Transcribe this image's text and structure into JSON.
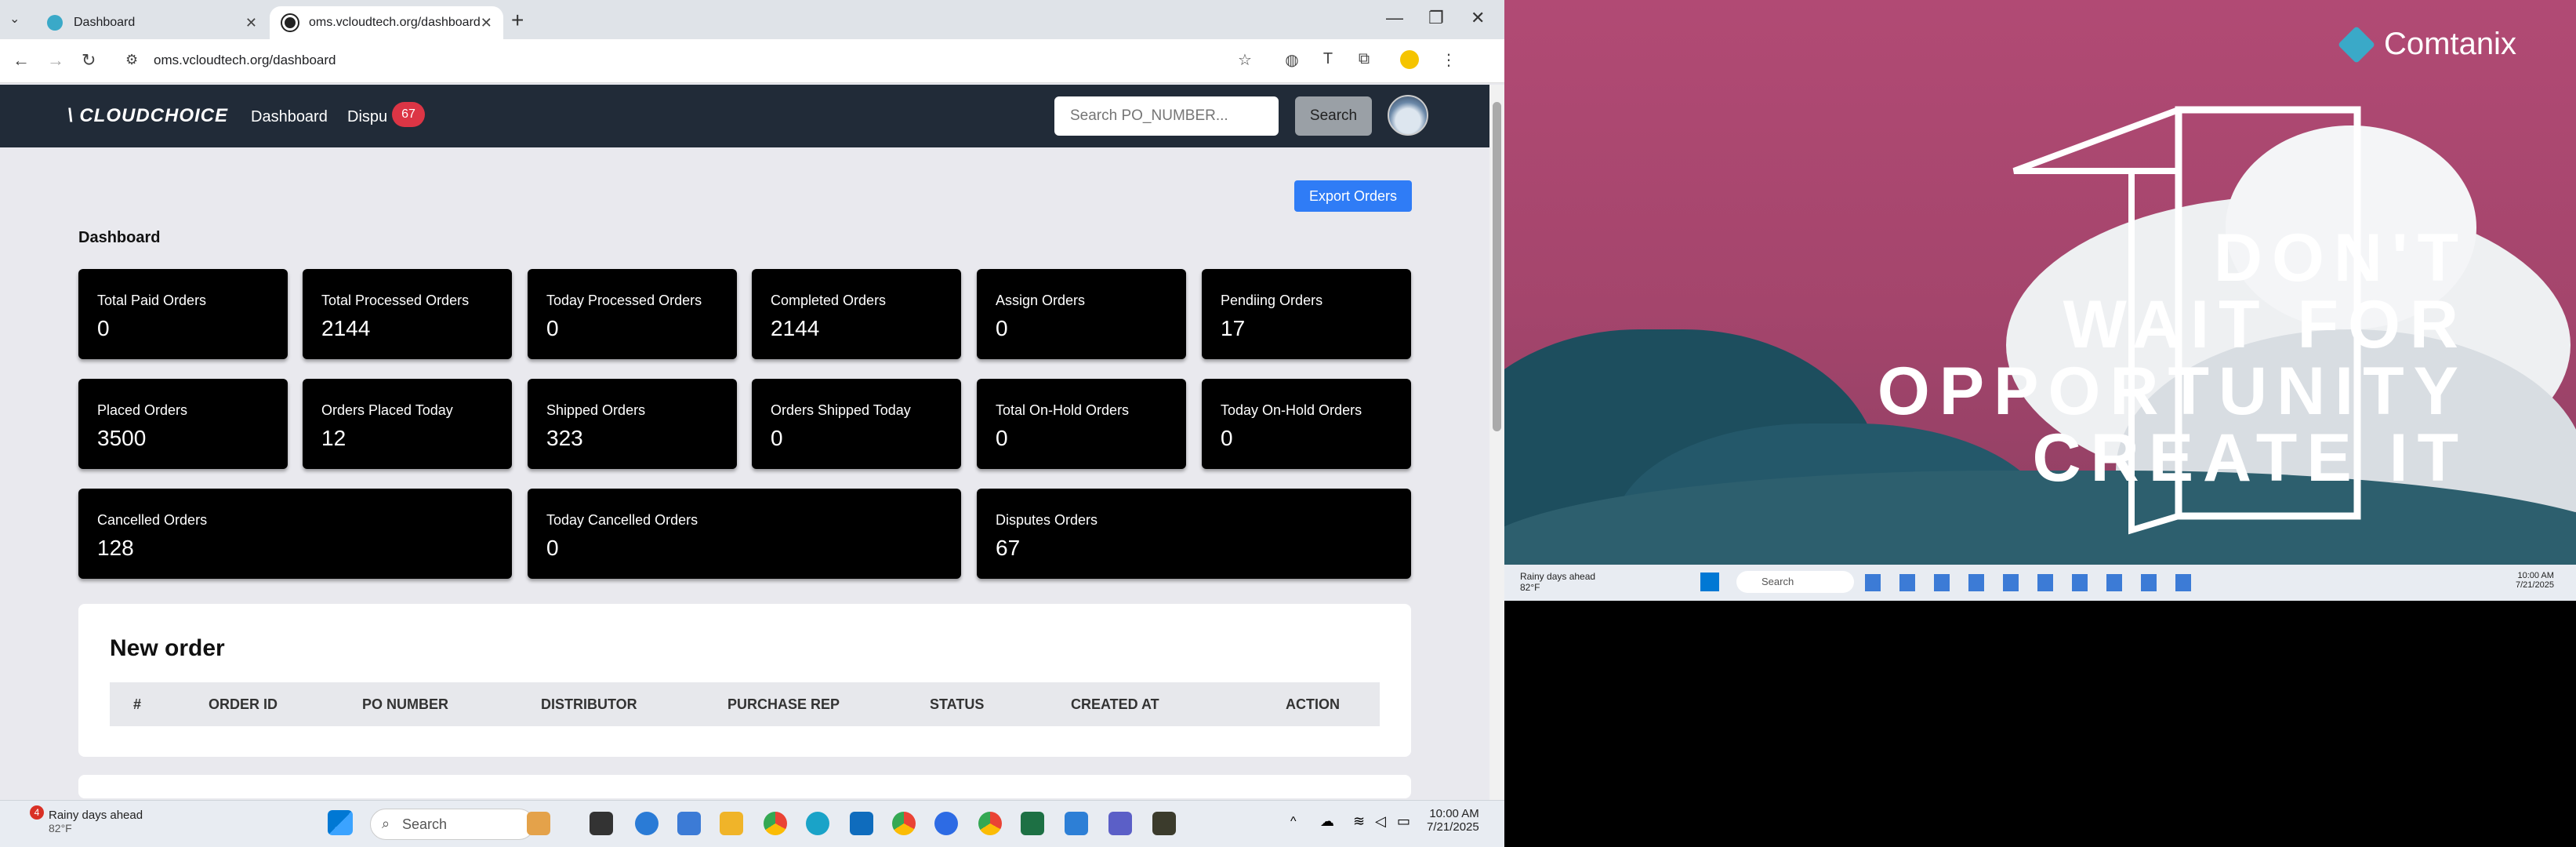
{
  "browser": {
    "tabs": [
      {
        "title": "Dashboard"
      },
      {
        "title": "oms.vcloudtech.org/dashboard"
      }
    ],
    "url": "oms.vcloudtech.org/dashboard"
  },
  "site": {
    "logo": "CLOUDCHOICE",
    "nav": {
      "dashboard": "Dashboard",
      "disputes": "Dispu",
      "disputes_badge": "67"
    },
    "search": {
      "placeholder": "Search PO_NUMBER...",
      "button": "Search"
    },
    "export_button": "Export Orders",
    "page_title": "Dashboard",
    "cards": [
      {
        "label": "Total Paid Orders",
        "value": "0"
      },
      {
        "label": "Total Processed Orders",
        "value": "2144"
      },
      {
        "label": "Today Processed Orders",
        "value": "0"
      },
      {
        "label": "Completed Orders",
        "value": "2144"
      },
      {
        "label": "Assign Orders",
        "value": "0"
      },
      {
        "label": "Pendiing Orders",
        "value": "17"
      },
      {
        "label": "Placed Orders",
        "value": "3500"
      },
      {
        "label": "Orders Placed Today",
        "value": "12"
      },
      {
        "label": "Shipped Orders",
        "value": "323"
      },
      {
        "label": "Orders Shipped Today",
        "value": "0"
      },
      {
        "label": "Total On-Hold Orders",
        "value": "0"
      },
      {
        "label": "Today On-Hold Orders",
        "value": "0"
      },
      {
        "label": "Cancelled Orders",
        "value": "128"
      },
      {
        "label": "Today Cancelled Orders",
        "value": "0"
      },
      {
        "label": "Disputes Orders",
        "value": "67"
      }
    ],
    "new_order": {
      "title": "New order",
      "columns": [
        "#",
        "ORDER ID",
        "PO NUMBER",
        "DISTRIBUTOR",
        "PURCHASE REP",
        "STATUS",
        "CREATED AT",
        "ACTION"
      ]
    }
  },
  "taskbar": {
    "weather_title": "Rainy days ahead",
    "weather_temp": "82°F",
    "weather_badge": "4",
    "search": "Search",
    "time": "10:00 AM",
    "date": "7/21/2025"
  },
  "wallpaper": {
    "brand": "Comtanix",
    "slogan": [
      "DON'T",
      "WAIT FOR",
      "OPPORTUNITY",
      "CREATE IT"
    ]
  },
  "colors": {
    "nav_bg": "#212b38",
    "card_bg": "#000000",
    "accent_blue": "#2f7cf6",
    "badge_red": "#dc3545",
    "wallpaper_pink": "#b14a74"
  }
}
